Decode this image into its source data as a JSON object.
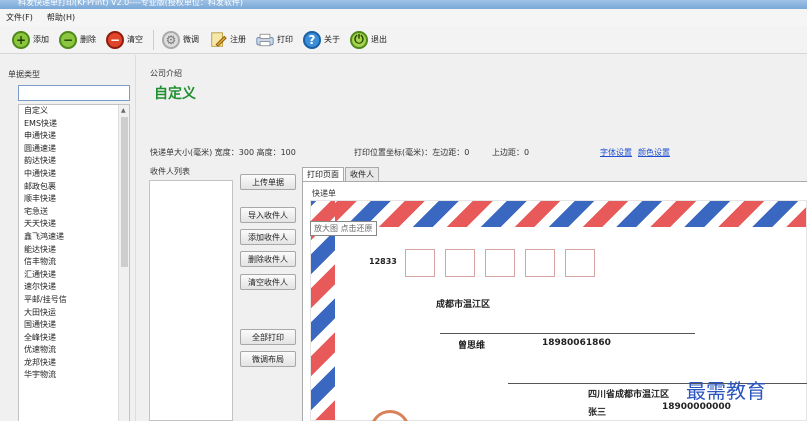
{
  "window": {
    "title": "科发快递单打印(KFPrint) V2.0----专业版(授权单位：科发软件)"
  },
  "menu": [
    "文件(F)",
    "帮助(H)"
  ],
  "toolbar": {
    "add": "添加",
    "delete": "删除",
    "clear": "清空",
    "adjust": "微调",
    "register": "注册",
    "print": "打印",
    "about": "关于",
    "exit": "退出"
  },
  "sidebar": {
    "heading": "单据类型",
    "filter_value": "",
    "items": [
      "自定义",
      "EMS快递",
      "申通快递",
      "圆通速递",
      "韵达快递",
      "中通快递",
      "邮政包裹",
      "顺丰快递",
      "宅急送",
      "天天快递",
      "鑫飞鸿速递",
      "能达快递",
      "信丰物流",
      "汇通快递",
      "速尔快递",
      "平邮/挂号信",
      "大田快运",
      "国通快递",
      "全峰快递",
      "优速物流",
      "龙邦快递",
      "华宇物流"
    ]
  },
  "company": {
    "label": "公司介绍",
    "name": "自定义"
  },
  "info": {
    "size": "快递单大小(毫米)  宽度：300  高度：100",
    "offset": "打印位置坐标(毫米)：左边距：0",
    "top_margin": "上边距：0",
    "font_settings": "字体设置",
    "color_settings": "颜色设置"
  },
  "receiver": {
    "label": "收件人列表"
  },
  "actions": {
    "upload": "上传单据",
    "import": "导入收件人",
    "add": "添加收件人",
    "delete": "删除收件人",
    "clear": "清空收件人",
    "print_all": "全部打印",
    "adjust_layout": "微调布局"
  },
  "tabs": [
    "打印页面",
    "收件人"
  ],
  "sheet": {
    "label": "快递单",
    "tooltip": "放大图 点击还原",
    "zip_digits": "12833",
    "sender_city": "成都市温江区",
    "sender_name": "曾思维",
    "sender_phone": "18980061860",
    "receiver_address": "四川省成都市温江区",
    "receiver_name": "张三",
    "receiver_phone": "18900000000"
  },
  "watermark": "最需教育",
  "colors": {
    "company_name": "#1f8f2f",
    "link": "#1f4fd0",
    "airmail_red": "#e85a5a",
    "airmail_blue": "#3a67bf"
  }
}
